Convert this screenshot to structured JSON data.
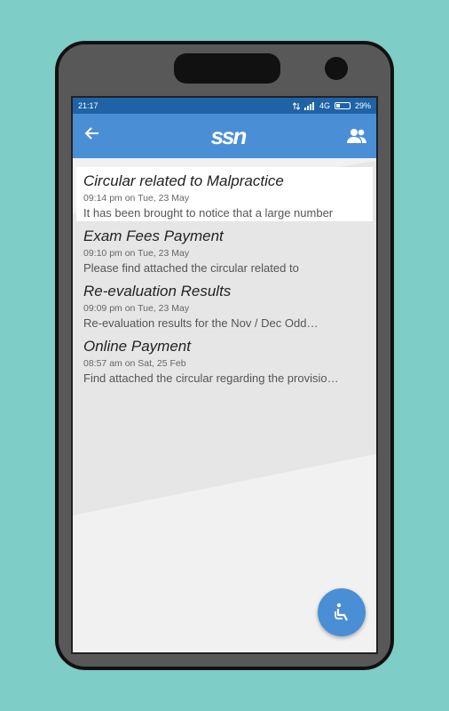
{
  "status": {
    "time": "21:17",
    "network": "4G",
    "battery": "29%",
    "battery_level": 0.29
  },
  "appbar": {
    "back_icon": "arrow-left-icon",
    "logo_text": "ssn",
    "people_icon": "people-icon"
  },
  "notices": [
    {
      "title": "Circular related to Malpractice",
      "time": "09:14 pm on Tue, 23 May",
      "preview": "It has been brought to notice that a large number"
    },
    {
      "title": "Exam Fees Payment",
      "time": "09:10 pm on Tue, 23 May",
      "preview": "Please find attached the circular related to"
    },
    {
      "title": "Re-evaluation Results",
      "time": "09:09 pm on Tue, 23 May",
      "preview": "Re-evaluation results for the Nov / Dec Odd…"
    },
    {
      "title": "Online Payment",
      "time": "08:57 am on Sat, 25 Feb",
      "preview": "Find attached the circular regarding the provisio…"
    }
  ],
  "fab": {
    "icon": "accessibility-icon"
  },
  "colors": {
    "background": "#7ecdc6",
    "statusbar": "#1f63a6",
    "appbar": "#4a8fd6"
  }
}
